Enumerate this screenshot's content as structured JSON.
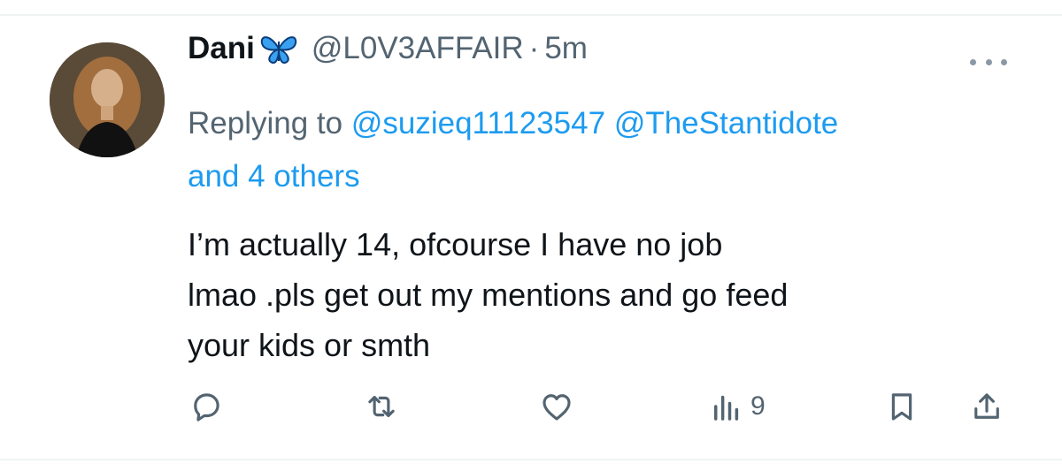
{
  "tweet": {
    "author": {
      "display_name": "Dani",
      "emoji": "butterfly-emoji",
      "handle": "@L0V3AFFAIR",
      "separator": "·",
      "time": "5m"
    },
    "more_icon": "more-icon",
    "reply": {
      "prefix": "Replying to",
      "mentions": [
        "@suzieq11123547",
        "@TheStantidote"
      ],
      "others": "and 4 others"
    },
    "text": "I’m actually 14, ofcourse I have no job\nlmao .pls get out my mentions and go feed\nyour kids or smth",
    "actions": {
      "reply_icon": "reply-icon",
      "retweet_icon": "retweet-icon",
      "like_icon": "heart-icon",
      "views_icon": "views-icon",
      "views_count": "9",
      "bookmark_icon": "bookmark-icon",
      "share_icon": "share-icon"
    }
  },
  "colors": {
    "text_primary": "#0f1419",
    "text_secondary": "#536471",
    "link": "#1d9bf0",
    "divider": "#eff3f4"
  }
}
